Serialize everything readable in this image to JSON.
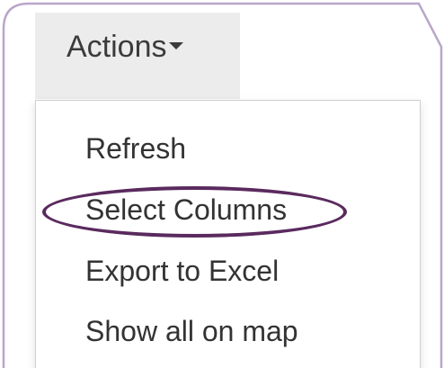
{
  "toolbar": {
    "actions_label": "Actions"
  },
  "menu": {
    "items": [
      {
        "label": "Refresh"
      },
      {
        "label": "Select Columns"
      },
      {
        "label": "Export to Excel"
      },
      {
        "label": "Show all on map"
      }
    ],
    "highlighted_item": "Select Columns"
  },
  "colors": {
    "frame_border": "#b9a6c9",
    "highlight_ring": "#5a2a5e",
    "button_background": "#ececec",
    "text": "#333333"
  },
  "icons": {
    "actions_caret": "chevron-down-icon"
  }
}
